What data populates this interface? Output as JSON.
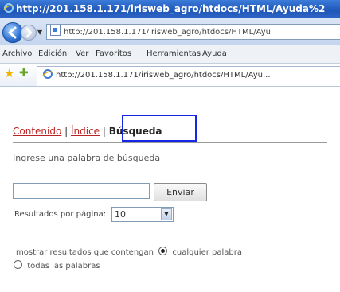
{
  "window": {
    "title": "http://201.158.1.171/irisweb_agro/htdocs/HTML/Ayuda%2"
  },
  "address_bar": {
    "url": "http://201.158.1.171/irisweb_agro/htdocs/HTML/Ayu"
  },
  "menu": {
    "items": [
      "Archivo",
      "Edición",
      "Ver",
      "Favoritos",
      "Herramientas",
      "Ayuda"
    ]
  },
  "tab": {
    "label": "http://201.158.1.171/irisweb_agro/htdocs/HTML/Ayu..."
  },
  "page": {
    "nav": {
      "contenido": "Contenido",
      "sep1": " | ",
      "indice": "Índice",
      "sep2": " | ",
      "busqueda": "Búsqueda"
    },
    "intro": "Ingrese una palabra de búsqueda",
    "search_value": "",
    "send_label": "Enviar",
    "per_page_label": "Resultados por página:",
    "per_page_value": "10",
    "show_label": "mostrar resultados que contengan",
    "option_any": "cualquier palabra",
    "option_all": "todas las palabras"
  },
  "colors": {
    "background": "#f9fa6a",
    "highlight": "#1626e8",
    "link": "#b22222"
  }
}
